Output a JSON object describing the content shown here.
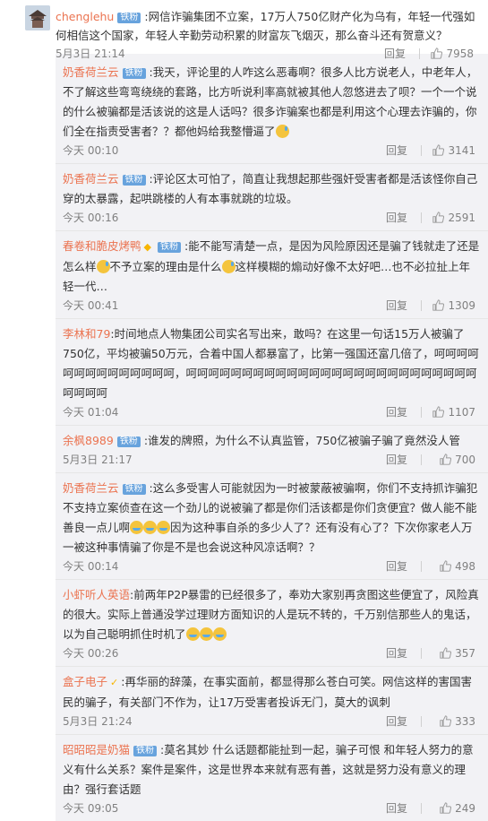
{
  "top_comment": {
    "user": "chenglehu",
    "badge": "铁粉",
    "text": ":网信诈骗集团不立案，17万人750亿财产化为乌有，年轻一代强如何相信这个国家，年轻人辛勤劳动积累的财富灰飞烟灭，那么奋斗还有贺意义？",
    "time": "5月3日 21:14",
    "reply_label": "回复",
    "likes": "7958"
  },
  "replies": [
    {
      "user": "奶香荷兰云",
      "badge": "铁粉",
      "text": ":我天，评论里的人咋这么恶毒啊？很多人比方说老人，中老年人，不了解这些弯弯绕绕的套路，比方听说利率高就被其他人忽悠进去了呗？一个一个说的什么被骗都是活该说的这是人话吗？很多诈骗案也都是利用这个心理去诈骗的，你们全在指责受害者？？都他妈给我整懵逼了",
      "time": "今天 00:10",
      "reply_label": "回复",
      "likes": "3141",
      "emoji": [
        "sweat"
      ]
    },
    {
      "user": "奶香荷兰云",
      "badge": "铁粉",
      "text": ":评论区太可怕了，简直让我想起那些强奸受害者都是活该怪你自己穿的太暴露，起哄跳楼的人有本事就跳的垃圾。",
      "time": "今天 00:16",
      "reply_label": "回复",
      "likes": "2591",
      "emoji": []
    },
    {
      "user": "春卷和脆皮烤鸭",
      "badge": "铁粉",
      "text_a": ":能不能写清楚一点，是因为风险原因还是骗了钱就走了还是怎么样",
      "text_b": "不予立案的理由是什么",
      "text_c": "这样模糊的煽动好像不太好吧…也不必拉扯上年轻一代…",
      "time": "今天 00:41",
      "reply_label": "回复",
      "likes": "1309"
    },
    {
      "user": "李林和79",
      "text": ":时间地点人物集团公司实名写出来，敢吗？在这里一句话15万人被骗了750亿，平均被骗50万元，合着中国人都暴富了，比第一强国还富几倍了，呵呵呵呵呵呵呵呵呵呵呵呵呵呵，呵呵呵呵呵呵呵呵呵呵呵呵呵呵呵呵呵呵呵呵呵呵呵呵呵呵呵呵呵呵",
      "time": "今天 01:04",
      "reply_label": "回复",
      "likes": "1107"
    },
    {
      "user": "余枫8989",
      "badge": "铁粉",
      "text": ":谁发的牌照，为什么不认真监管，750亿被骗子骗了竟然没人管",
      "time": "5月3日 21:17",
      "reply_label": "回复",
      "likes": "700"
    },
    {
      "user": "奶香荷兰云",
      "badge": "铁粉",
      "text_a": ":这么多受害人可能就因为一时被蒙蔽被骗啊，你们不支持抓诈骗犯不支持立案侦查在这一个劲儿的说被骗了都是你们活该都是你们贪便宜？做人能不能善良一点儿啊",
      "text_b": "因为这种事自杀的多少人了？还有没有心了？下次你家老人万一被这种事情骗了你是不是也会说这种风凉话啊？？",
      "time": "今天 00:14",
      "reply_label": "回复",
      "likes": "498"
    },
    {
      "user": "小虾听人英语",
      "text_a": ":前两年P2P暴雷的已经很多了，奉劝大家别再贪图这些便宜了，风险真的很大。实际上普通没学过理财方面知识的人是玩不转的，千万别信那些人的鬼话，以为自己聪明抓住时机了",
      "time": "今天 00:26",
      "reply_label": "回复",
      "likes": "357"
    },
    {
      "user": "盒子电子",
      "text": ":再华丽的辞藻，在事实面前，都显得那么苍白可笑。网信这样的害国害民的骗子，有关部门不作为，让17万受害者投诉无门，莫大的讽刺",
      "time": "5月3日 21:24",
      "reply_label": "回复",
      "likes": "333"
    },
    {
      "user": "昭昭昭是奶猫",
      "badge": "铁粉",
      "text": ":莫名其妙 什么话题都能扯到一起，骗子可恨 和年轻人努力的意义有什么关系？案件是案件，这是世界本来就有恶有善，这就是努力没有意义的理由？强行套话题",
      "time": "今天 09:05",
      "reply_label": "回复",
      "likes": "249",
      "emoji": [
        "sweat"
      ]
    }
  ]
}
